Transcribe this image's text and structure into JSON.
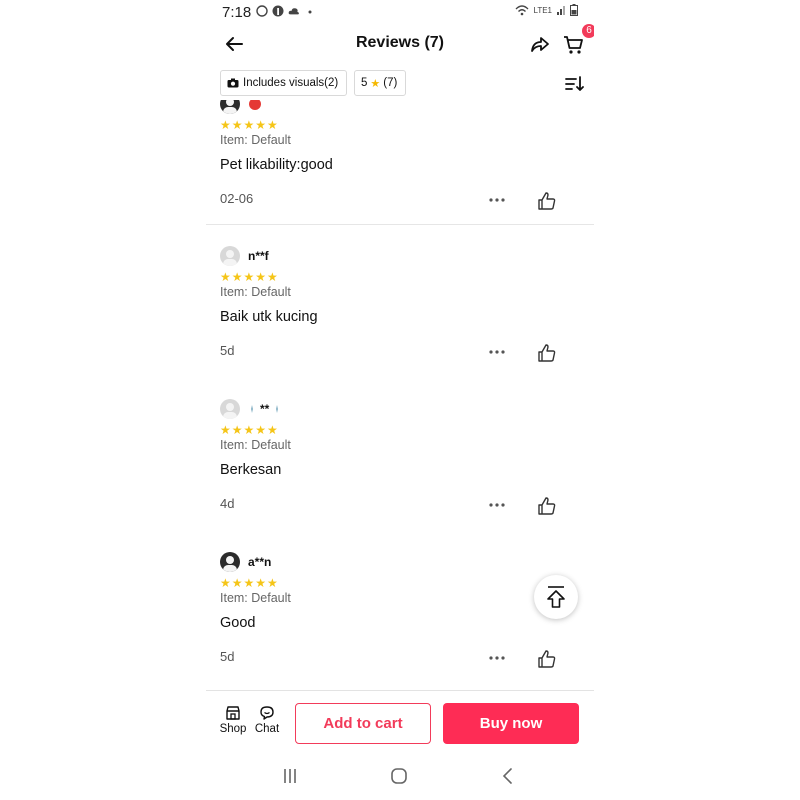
{
  "status_bar": {
    "time": "7:18",
    "cart_badge": "6",
    "network": "LTE1"
  },
  "header": {
    "title": "Reviews (7)"
  },
  "filters": [
    {
      "label": "Includes visuals(2)"
    },
    {
      "rating": "5",
      "count": "(7)"
    }
  ],
  "reviews": [
    {
      "user": "",
      "stars": "★★★★★",
      "item": "Item: Default",
      "text": "Pet likability:good",
      "date": "02-06"
    },
    {
      "user": "n**f",
      "stars": "★★★★★",
      "item": "Item: Default",
      "text": "Baik utk kucing",
      "date": "5d"
    },
    {
      "user": "**",
      "stars": "★★★★★",
      "item": "Item: Default",
      "text": "Berkesan",
      "date": "4d"
    },
    {
      "user": "a**n",
      "stars": "★★★★★",
      "item": "Item: Default",
      "text": "Good",
      "date": "5d"
    }
  ],
  "bottom_bar": {
    "shop_label": "Shop",
    "chat_label": "Chat",
    "add_to_cart": "Add to cart",
    "buy_now": "Buy now"
  },
  "colors": {
    "accent": "#fe2c55",
    "star": "#f5c518"
  },
  "icons": [
    "back-arrow-icon",
    "share-icon",
    "cart-icon",
    "camera-icon",
    "sort-icon",
    "more-icon",
    "thumbs-up-icon",
    "scroll-top-icon",
    "shop-icon",
    "chat-icon"
  ]
}
